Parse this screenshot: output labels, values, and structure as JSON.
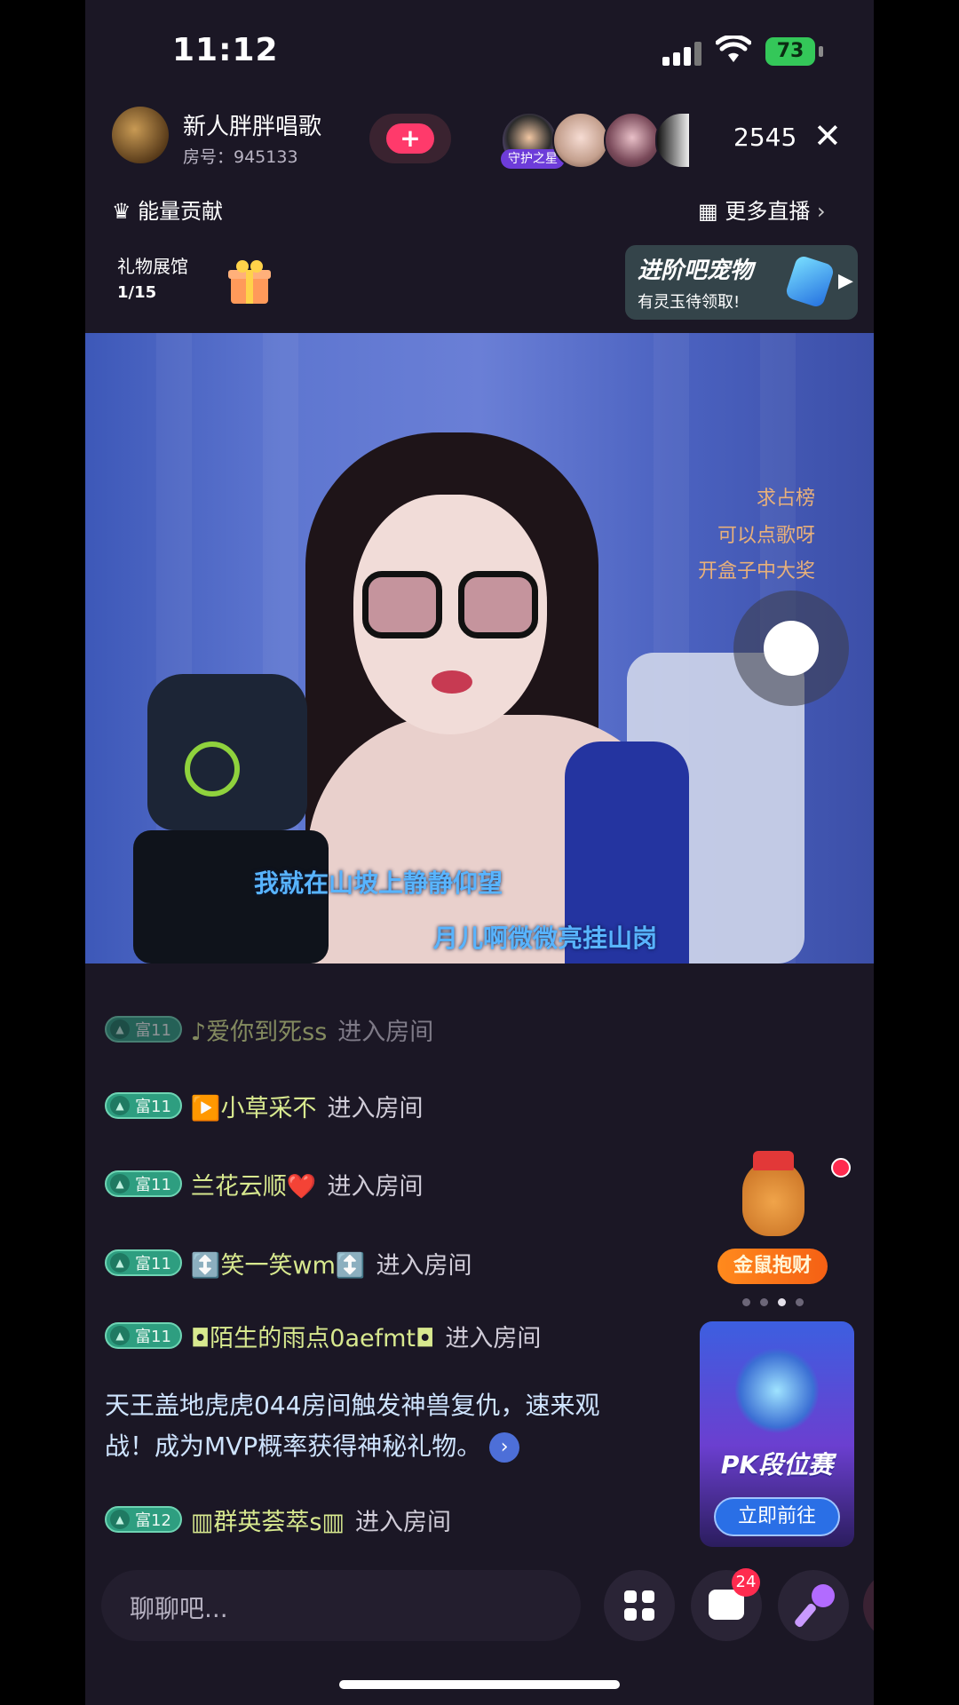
{
  "status_bar": {
    "time": "11:12",
    "battery": "73"
  },
  "host": {
    "name": "新人胖胖唱歌",
    "room_label": "房号：945133"
  },
  "viewers": {
    "guard_badge": "守护之星",
    "count": "2545"
  },
  "nav": {
    "energy": "能量贡献",
    "more_live": "更多直播"
  },
  "gift_hall": {
    "title": "礼物展馆",
    "count": "1/15"
  },
  "pet_banner": {
    "title": "进阶吧宠物",
    "subtitle": "有灵玉待领取!"
  },
  "video": {
    "notes": [
      "求占榜",
      "可以点歌呀",
      "开盒子中大奖"
    ],
    "lyric_line1": "我就在山坡上静静仰望",
    "lyric_line2": "月儿啊微微亮挂山岗"
  },
  "chat": {
    "messages": [
      {
        "level": "富11",
        "name": "♪爱你到死ss",
        "action": "进入房间"
      },
      {
        "level": "富11",
        "name": "▶️小草采不",
        "action": "进入房间"
      },
      {
        "level": "富11",
        "name": "兰花云顺❤️",
        "action": "进入房间"
      },
      {
        "level": "富11",
        "name": "↕️笑一笑wm↕️",
        "action": "进入房间"
      },
      {
        "level": "富11",
        "name": "◘陌生的雨点0aefmt◘",
        "action": "进入房间"
      },
      {
        "level": "富12",
        "name": "▥群英荟萃s▥",
        "action": "进入房间"
      }
    ],
    "announcement": "天王盖地虎虎044房间触发神兽复仇，速来观战！成为MVP概率获得神秘礼物。"
  },
  "activity": {
    "label": "金鼠抱财"
  },
  "pk_banner": {
    "title": "PK段位赛",
    "button": "立即前往"
  },
  "bottom": {
    "chat_placeholder": "聊聊吧...",
    "unread_count": "24"
  },
  "colors": {
    "background": "#1b1725",
    "badge": "#2e9e80",
    "accent_red": "#ff2b4f",
    "lyric": "#58b4ff"
  }
}
